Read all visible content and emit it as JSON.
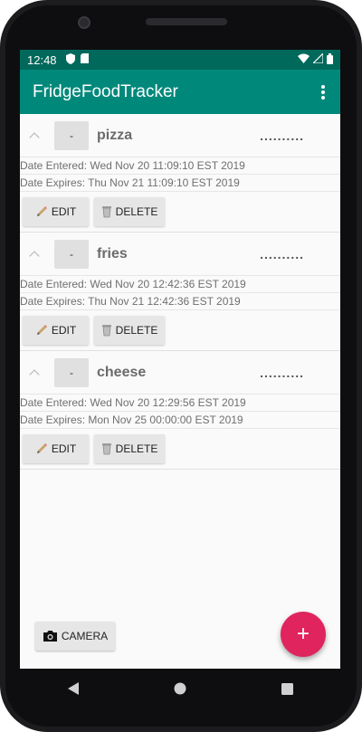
{
  "status_bar": {
    "time": "12:48"
  },
  "app_bar": {
    "title": "FridgeFoodTracker"
  },
  "items": [
    {
      "name": "pizza",
      "minus_label": "-",
      "dots": "..........",
      "entered": "Date Entered: Wed Nov 20 11:09:10 EST 2019",
      "expires": "Date Expires: Thu Nov 21 11:09:10 EST 2019",
      "edit_label": "EDIT",
      "delete_label": "DELETE"
    },
    {
      "name": "fries",
      "minus_label": "-",
      "dots": "..........",
      "entered": "Date Entered: Wed Nov 20 12:42:36 EST 2019",
      "expires": "Date Expires: Thu Nov 21 12:42:36 EST 2019",
      "edit_label": "EDIT",
      "delete_label": "DELETE"
    },
    {
      "name": "cheese",
      "minus_label": "-",
      "dots": "..........",
      "entered": "Date Entered: Wed Nov 20 12:29:56 EST 2019",
      "expires": "Date Expires: Mon Nov 25 00:00:00 EST 2019",
      "edit_label": "EDIT",
      "delete_label": "DELETE"
    }
  ],
  "camera_button": {
    "label": "CAMERA"
  },
  "fab": {
    "label": "+"
  },
  "colors": {
    "status_bar": "#00695c",
    "app_bar": "#00897b",
    "fab": "#e0245e"
  }
}
